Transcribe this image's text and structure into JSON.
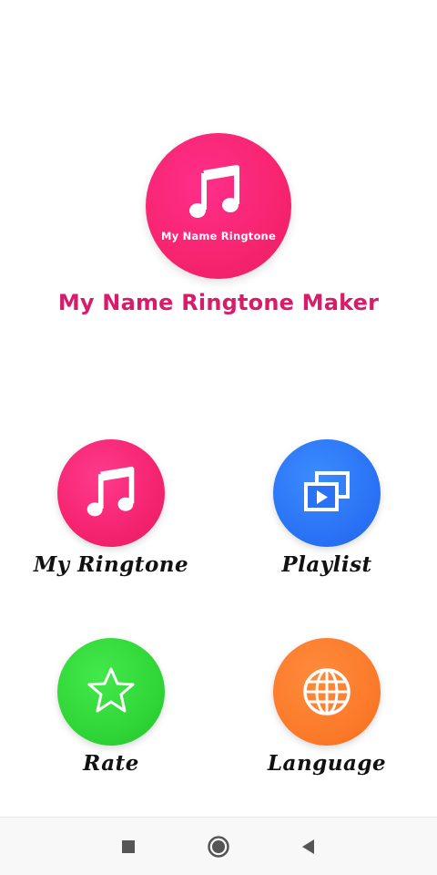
{
  "logo": {
    "caption": "My Name Ringtone",
    "icon": "music-note-icon"
  },
  "app": {
    "title": "My Name Ringtone Maker"
  },
  "menu": {
    "items": [
      {
        "label": "My Ringtone",
        "icon": "music-note-icon",
        "color": "#f4226e"
      },
      {
        "label": "Playlist",
        "icon": "playlist-icon",
        "color": "#2a72f5"
      },
      {
        "label": "Rate",
        "icon": "star-icon",
        "color": "#2fd437"
      },
      {
        "label": "Language",
        "icon": "globe-icon",
        "color": "#fb7a2a"
      }
    ]
  },
  "navbar": {
    "buttons": [
      "recents-icon",
      "home-icon",
      "back-icon"
    ]
  },
  "colors": {
    "title": "#d81b6a",
    "logo_background": "#f7246f"
  }
}
